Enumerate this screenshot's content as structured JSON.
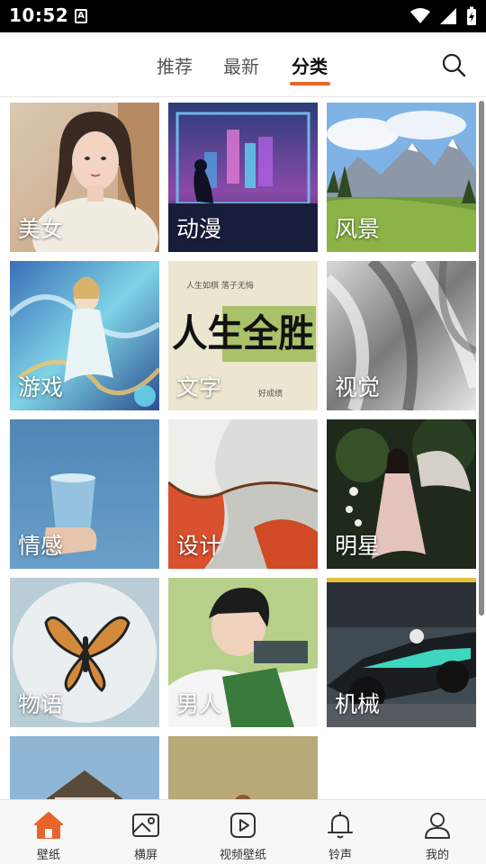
{
  "status_bar": {
    "time": "10:52",
    "notification_letter": "A"
  },
  "header": {
    "tabs": [
      {
        "label": "推荐"
      },
      {
        "label": "最新"
      },
      {
        "label": "分类"
      }
    ],
    "active_tab": "分类"
  },
  "categories": [
    {
      "label": "美女"
    },
    {
      "label": "动漫"
    },
    {
      "label": "风景"
    },
    {
      "label": "游戏"
    },
    {
      "label": "文字"
    },
    {
      "label": "视觉"
    },
    {
      "label": "情感"
    },
    {
      "label": "设计"
    },
    {
      "label": "明星"
    },
    {
      "label": "物语"
    },
    {
      "label": "男人"
    },
    {
      "label": "机械"
    }
  ],
  "tile_art": {
    "calligraphy_main": "人生全胜"
  },
  "bottom_nav": [
    {
      "label": "壁纸",
      "icon": "home-icon",
      "active": true
    },
    {
      "label": "横屏",
      "icon": "image-icon",
      "active": false
    },
    {
      "label": "视频壁纸",
      "icon": "video-play-icon",
      "active": false
    },
    {
      "label": "铃声",
      "icon": "bell-icon",
      "active": false
    },
    {
      "label": "我的",
      "icon": "person-icon",
      "active": false
    }
  ],
  "colors": {
    "accent": "#e8642a",
    "status_bar": "#000000"
  }
}
